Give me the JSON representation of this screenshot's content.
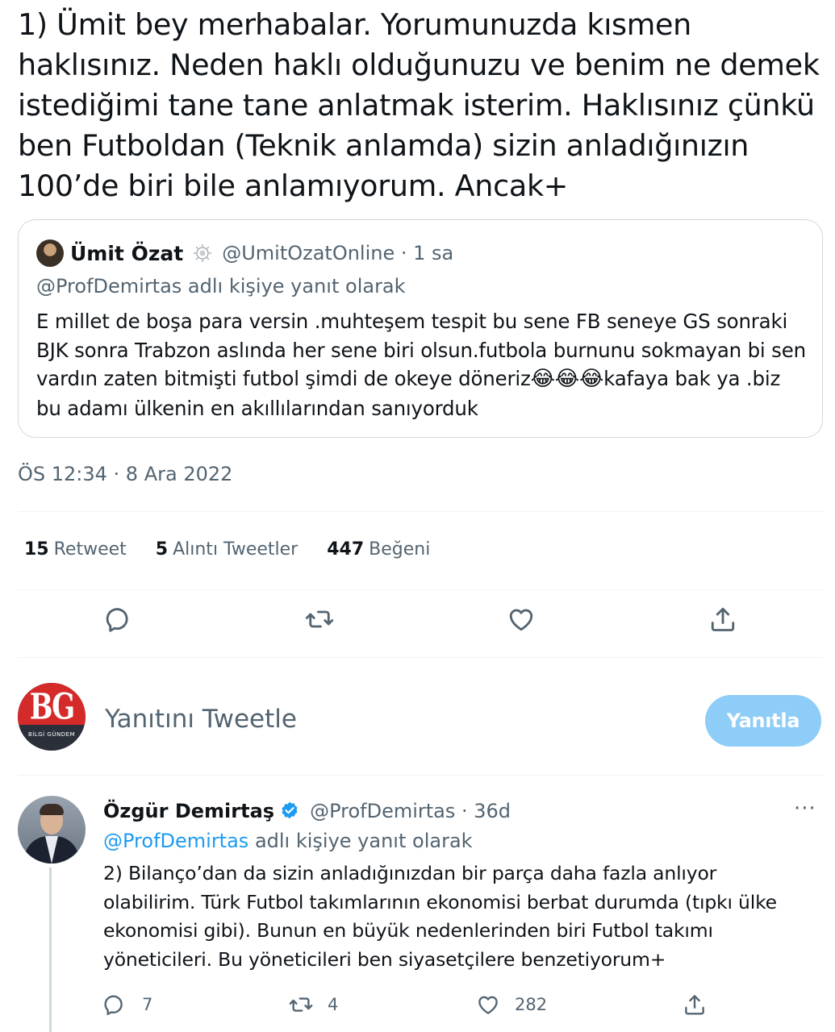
{
  "tweet": {
    "text": "1) Ümit bey merhabalar. Yorumunuzda kısmen haklısınız. Neden haklı olduğunuzu ve benim ne demek istediğimi tane tane anlatmak isterim. Haklısınız çünkü ben Futboldan (Teknik anlamda) sizin anladığınızın 100’de biri bile anlamıyorum. Ancak+",
    "timestamp": "ÖS 12:34 · 8 Ara 2022"
  },
  "quoted": {
    "name": "Ümit Özat",
    "handle_time": "@UmitOzatOnline · 1 sa",
    "reply_to": "@ProfDemirtas adlı kişiye yanıt olarak",
    "body_before": "E millet de boşa para versin .muhteşem tespit bu sene FB seneye GS sonraki BJK sonra Trabzon aslında her sene biri olsun.futbola burnunu sokmayan bi sen vardın zaten bitmişti futbol şimdi de okeye döneriz",
    "emojis": "😂😂😂",
    "body_after": "kafaya bak ya .biz bu adamı ülkenin en akıllılarından sanıyorduk",
    "icons": {
      "avatar": "avatar-photo",
      "badge": "badge-icon"
    }
  },
  "stats": {
    "retweets": {
      "num": "15",
      "label": "Retweet"
    },
    "quotes": {
      "num": "5",
      "label": "Alıntı Tweetler"
    },
    "likes": {
      "num": "447",
      "label": "Beğeni"
    }
  },
  "actions": {
    "icons": [
      "reply-icon",
      "retweet-icon",
      "like-icon",
      "share-icon"
    ]
  },
  "composer": {
    "avatar_text": "BG",
    "avatar_subtext": "BİLGİ GÜNDEM",
    "placeholder": "Yanıtını Tweetle",
    "reply_button": "Yanıtla"
  },
  "reply": {
    "name": "Özgür Demirtaş",
    "handle_time": "@ProfDemirtas · 36d",
    "more": "···",
    "reply_mention": "@ProfDemirtas",
    "reply_rest": " adlı kişiye yanıt olarak",
    "body": "2) Bilanço’dan da sizin anladığınızdan bir parça daha fazla anlıyor olabilirim. Türk Futbol takımlarının ekonomisi berbat durumda (tıpkı ülke ekonomisi gibi). Bunun en büyük nedenlerinden biri Futbol takımı yöneticileri. Bu yöneticileri ben siyasetçilere benzetiyorum+",
    "counts": {
      "replies": "7",
      "retweets": "4",
      "likes": "282"
    }
  },
  "colors": {
    "text": "#0f1419",
    "secondary": "#536471",
    "accent": "#1d9bf0",
    "reply_button_disabled": "#8ecdf8",
    "border": "#cfd9de"
  }
}
